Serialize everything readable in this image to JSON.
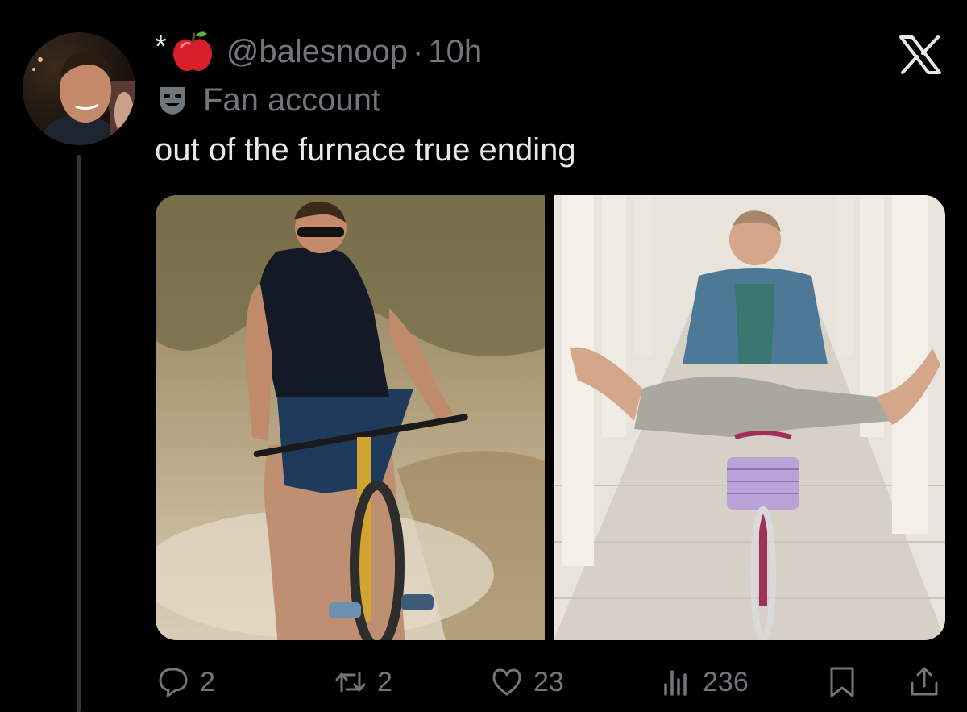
{
  "tweet": {
    "display_name": "*",
    "handle": "@balesnoop",
    "separator": "·",
    "time": "10h",
    "label": "Fan account",
    "text": "out of the furnace true ending"
  },
  "actions": {
    "replies": "2",
    "reposts": "2",
    "likes": "23",
    "views": "236"
  },
  "icons": {
    "name_emoji": "red-apple-icon",
    "label_emoji": "theater-mask-icon",
    "close": "x-logo-icon"
  },
  "colors": {
    "background": "#000000",
    "text": "#e7e9ea",
    "secondary": "#71767b",
    "thread_line": "#333639"
  }
}
